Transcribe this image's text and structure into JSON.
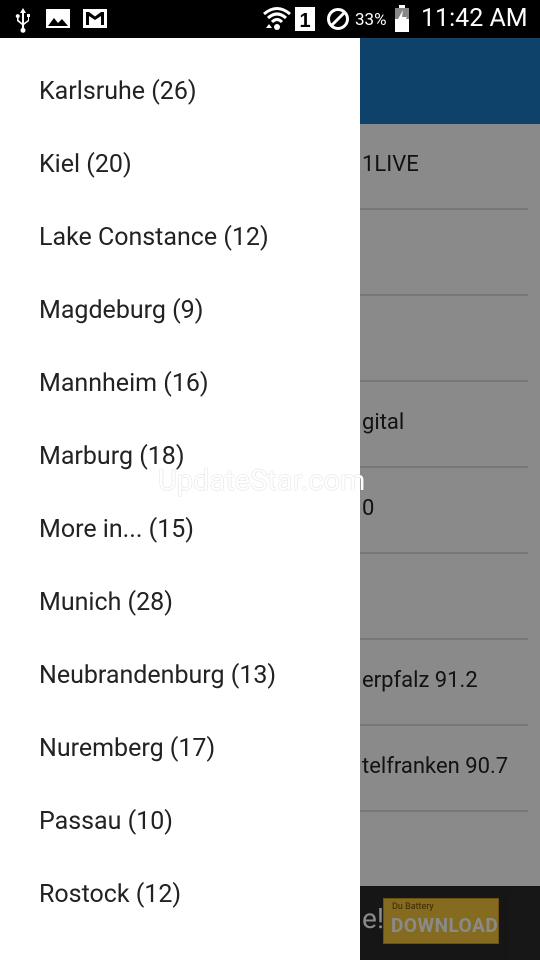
{
  "status_bar": {
    "battery_percent": "33%",
    "time": "11:42 AM",
    "sim_slot": "1",
    "icons": [
      "usb-icon",
      "image-icon",
      "gmail-icon",
      "wifi-icon",
      "sim-icon",
      "do-not-disturb-icon",
      "battery-charging-icon"
    ]
  },
  "drawer": {
    "items": [
      {
        "label": "Karlsruhe (26)"
      },
      {
        "label": "Kiel (20)"
      },
      {
        "label": "Lake Constance (12)"
      },
      {
        "label": "Magdeburg (9)"
      },
      {
        "label": "Mannheim (16)"
      },
      {
        "label": "Marburg (18)"
      },
      {
        "label": "More in... (15)"
      },
      {
        "label": "Munich (28)"
      },
      {
        "label": "Neubrandenburg (13)"
      },
      {
        "label": "Nuremberg (17)"
      },
      {
        "label": "Passau (10)"
      },
      {
        "label": "Rostock (12)"
      }
    ]
  },
  "background_list": {
    "rows": [
      {
        "label": "1LIVE"
      },
      {
        "label": ""
      },
      {
        "label": ""
      },
      {
        "label": "gital"
      },
      {
        "label": "0"
      },
      {
        "label": ""
      },
      {
        "label": "erpfalz 91.2"
      },
      {
        "label": "telfranken 90.7"
      }
    ]
  },
  "ad_banner": {
    "exclamation": "e!",
    "button_small": "Du Battery",
    "button_label": "DOWNLOAD"
  },
  "watermark": {
    "text": "UpdateStar.com"
  },
  "colors": {
    "toolbar": "#1a7ac4",
    "drawer_bg": "#ffffff",
    "status_bar": "#000000",
    "ad_button": "#f6c63a"
  }
}
